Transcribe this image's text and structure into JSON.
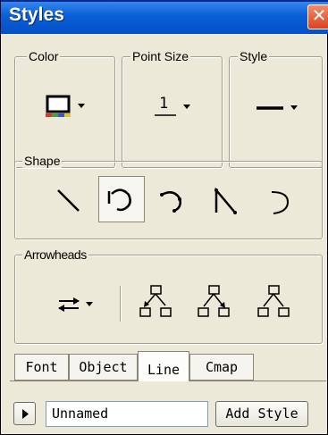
{
  "window": {
    "title": "Styles",
    "close_glyph": "✕"
  },
  "groups": {
    "color": {
      "label": "Color",
      "icon": "color-palette-icon"
    },
    "point_size": {
      "label": "Point Size",
      "value": "1"
    },
    "style": {
      "label": "Style",
      "icon": "solid-line-icon"
    },
    "shape": {
      "label": "Shape",
      "options": [
        {
          "icon": "straight-line-icon"
        },
        {
          "icon": "bent-arc-icon",
          "selected": true
        },
        {
          "icon": "bent-arc-dots-icon"
        },
        {
          "icon": "angled-line-icon"
        },
        {
          "icon": "arc-icon"
        }
      ]
    },
    "arrowheads": {
      "label": "Arrowheads",
      "icons": [
        "arrow-direction-dropdown-icon",
        "tree-arrow-left-icon",
        "tree-arrow-middle-icon",
        "tree-arrow-right-icon"
      ]
    }
  },
  "tabs": [
    {
      "label": "Font"
    },
    {
      "label": "Object"
    },
    {
      "label": "Line",
      "active": true
    },
    {
      "label": "Cmap"
    }
  ],
  "footer": {
    "style_name": "Unnamed",
    "add_style_label": "Add Style"
  },
  "colors": {
    "titlebar": "#0a5fd6",
    "face": "#ece9d8",
    "close": "#d8431c"
  }
}
